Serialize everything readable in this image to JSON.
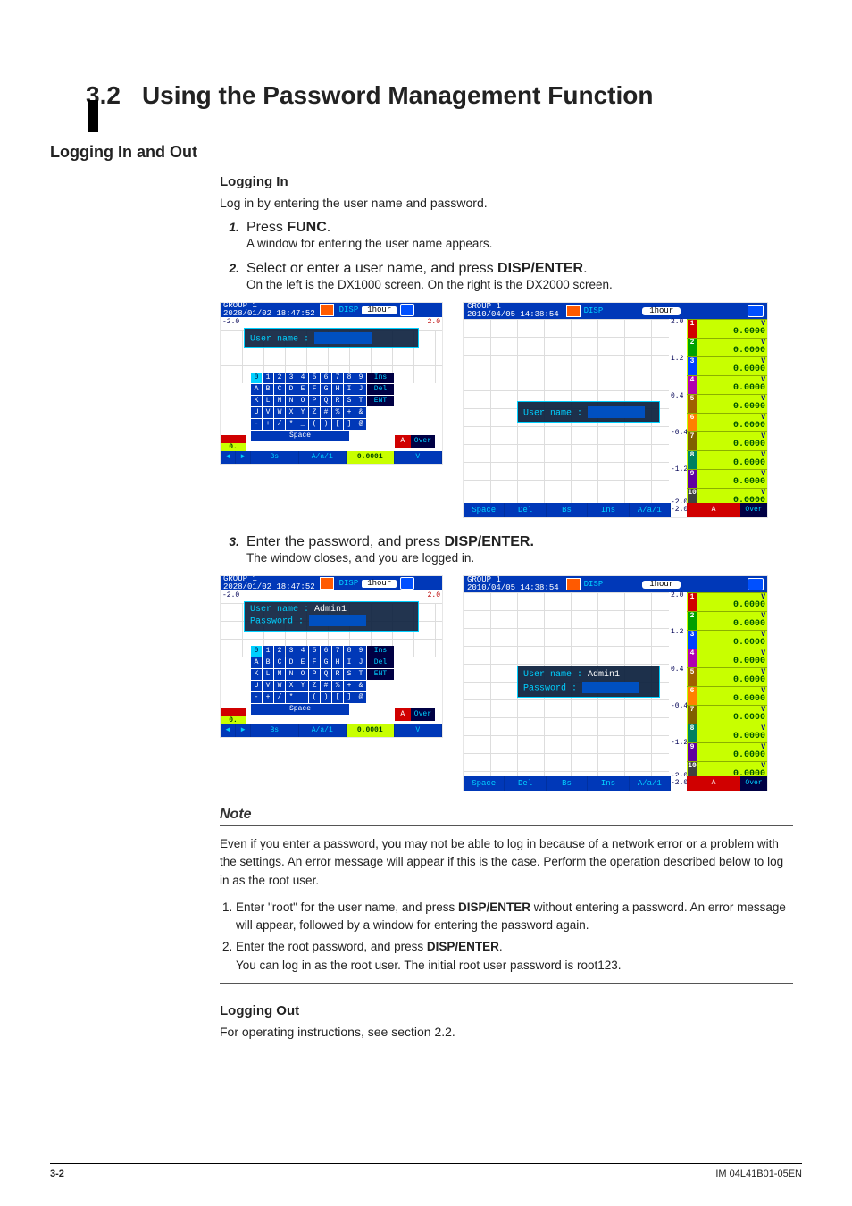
{
  "page": {
    "section_number": "3.2",
    "section_title": "Using the Password Management Function",
    "footer_left": "3-2",
    "footer_right": "IM 04L41B01-05EN"
  },
  "h2_logging": "Logging In and Out",
  "h3_login": "Logging In",
  "login_intro": "Log in by entering the user name and password.",
  "steps12": [
    {
      "n": "1.",
      "body": "Press <b>FUNC</b>.",
      "sub": "A window for entering the user name appears."
    },
    {
      "n": "2.",
      "body": "Select or enter a user name, and press <b>DISP/ENTER</b>.",
      "sub": "On the left is the DX1000 screen. On the right is the DX2000 screen."
    }
  ],
  "step3": {
    "n": "3.",
    "body": "Enter the password, and press <b>DISP/ENTER.</b>",
    "sub": "The window closes, and you are logged in."
  },
  "screens": {
    "dx1000": {
      "group": "GROUP 1",
      "ts": "2028/01/02 18:47:52",
      "disp": "DISP",
      "dur": "1hour",
      "scale_top_left": "-2.0",
      "scale_top_right": "2.0",
      "un_label": "User  name :",
      "un_value": "",
      "un_value2": "Admin1",
      "pw_label": "Password  :",
      "keys_row0": [
        "0",
        "1",
        "2",
        "3",
        "4",
        "5",
        "6",
        "7",
        "8",
        "9"
      ],
      "keys_row1": [
        "A",
        "B",
        "C",
        "D",
        "E",
        "F",
        "G",
        "H",
        "I",
        "J"
      ],
      "keys_row2": [
        "K",
        "L",
        "M",
        "N",
        "O",
        "P",
        "Q",
        "R",
        "S",
        "T"
      ],
      "keys_row3": [
        "U",
        "V",
        "W",
        "X",
        "Y",
        "Z",
        "#",
        "%",
        "+",
        "&"
      ],
      "keys_row4": [
        "-",
        "+",
        "/",
        "*",
        "_",
        "(",
        ")",
        "[",
        "]",
        "@"
      ],
      "side_keys": [
        "Ins",
        "Del",
        "ENT"
      ],
      "space": "Space",
      "over_a": "A",
      "over_ov": "Over",
      "corner_val": "0.",
      "bot": [
        "◄",
        "►",
        "Bs",
        "A/a/1",
        "0.0001",
        "V"
      ]
    },
    "dx2000": {
      "group": "GROUP 1",
      "ts": "2010/04/05 14:38:54",
      "disp": "DISP",
      "dur": "1hour",
      "un_label": "User  name  :",
      "un_value": "",
      "un_value2": "Admin1",
      "pw_label": "Password   :",
      "ticks": [
        "2.0",
        "1.2",
        "0.4",
        "-0.4",
        "-1.2",
        "-2.0"
      ],
      "channels": [
        {
          "ch": "1",
          "color": "#d00000",
          "unit": "V",
          "val": "0.0000"
        },
        {
          "ch": "2",
          "color": "#00a000",
          "unit": "V",
          "val": "0.0000"
        },
        {
          "ch": "3",
          "color": "#0040ff",
          "unit": "V",
          "val": "0.0000"
        },
        {
          "ch": "4",
          "color": "#b000b0",
          "unit": "V",
          "val": "0.0000"
        },
        {
          "ch": "5",
          "color": "#a06000",
          "unit": "V",
          "val": "0.0000"
        },
        {
          "ch": "6",
          "color": "#ff8000",
          "unit": "V",
          "val": "0.0000"
        },
        {
          "ch": "7",
          "color": "#806000",
          "unit": "V",
          "val": "0.0000"
        },
        {
          "ch": "8",
          "color": "#008060",
          "unit": "V",
          "val": "0.0000"
        },
        {
          "ch": "9",
          "color": "#6000a0",
          "unit": "V",
          "val": "0.0000"
        },
        {
          "ch": "10",
          "color": "#404040",
          "unit": "V",
          "val": "0.0000"
        }
      ],
      "bot": [
        "Space",
        "Del",
        "Bs",
        "Ins",
        "A/a/1"
      ],
      "corner_tick": "-2.0",
      "corner_a": "A",
      "corner_ov": "Over"
    }
  },
  "note": {
    "title": "Note",
    "para": "Even if you enter a password, you may not be able to log in because of a network error or a problem with the settings. An error message will appear if this is the case. Perform the operation described below to log in as the root user.",
    "list": [
      "Enter \"root\" for the user name, and press <b>DISP/ENTER</b> without entering a password. An error message will appear, followed by a window for entering the password again.",
      "Enter the root password, and press <b>DISP/ENTER</b>.<br>You can log in as the root user. The initial root user password is root123."
    ]
  },
  "h3_logout": "Logging Out",
  "logout_text": "For operating instructions, see section 2.2."
}
